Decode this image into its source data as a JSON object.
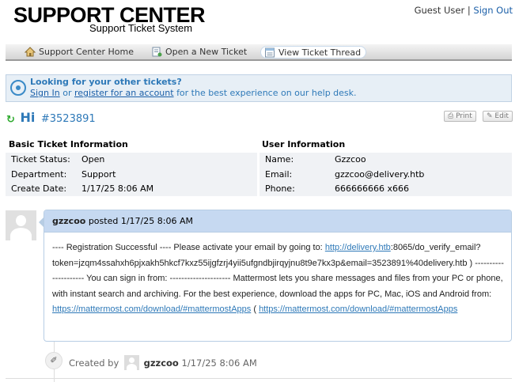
{
  "header": {
    "logo_main": "SUPPORT CENTER",
    "logo_sub": "Support Ticket System",
    "user_label": "Guest User",
    "separator": "|",
    "sign_out": "Sign Out"
  },
  "nav": {
    "items": [
      {
        "label": "Support Center Home",
        "icon": "home-icon"
      },
      {
        "label": "Open a New Ticket",
        "icon": "new-ticket-icon"
      },
      {
        "label": "View Ticket Thread",
        "icon": "ticket-thread-icon",
        "active": true
      }
    ]
  },
  "notice": {
    "title": "Looking for your other tickets?",
    "sign_in": "Sign In",
    "or": "or",
    "register": "register for an account",
    "tail": "for the best experience on our help desk."
  },
  "ticket": {
    "greeting": "Hi",
    "number": "#3523891",
    "print_label": "Print",
    "edit_label": "Edit"
  },
  "basic_info": {
    "heading": "Basic Ticket Information",
    "rows": [
      {
        "label": "Ticket Status:",
        "value": "Open"
      },
      {
        "label": "Department:",
        "value": "Support"
      },
      {
        "label": "Create Date:",
        "value": "1/17/25 8:06 AM"
      }
    ]
  },
  "user_info": {
    "heading": "User Information",
    "rows": [
      {
        "label": "Name:",
        "value": "Gzzcoo"
      },
      {
        "label": "Email:",
        "value": "gzzcoo@delivery.htb"
      },
      {
        "label": "Phone:",
        "value": "666666666 x666"
      }
    ]
  },
  "thread": {
    "author": "gzzcoo",
    "posted_word": "posted",
    "posted_date": "1/17/25 8:06 AM",
    "body_1": "---- Registration Successful ---- Please activate your email by going to: ",
    "link_1": "http://delivery.htb",
    "body_2": ":8065/do_verify_email?token=jzqm4ssahxh6pjxakh5hkcf7kxz55ijgfzrj4yii5ufgndbjirqyjnu8t9e7kx3p&email=3523891%40delivery.htb ) --------------------- You can sign in from: --------------------- Mattermost lets you share messages and files from your PC or phone, with instant search and archiving. For the best experience, download the apps for PC, Mac, iOS and Android from: ",
    "link_2": "https://mattermost.com/download/#mattermostApps",
    "body_3": " ( ",
    "link_3": "https://mattermost.com/download/#mattermostApps"
  },
  "event": {
    "created_by": "Created by",
    "author": "gzzcoo",
    "date": "1/17/25 8:06 AM"
  }
}
